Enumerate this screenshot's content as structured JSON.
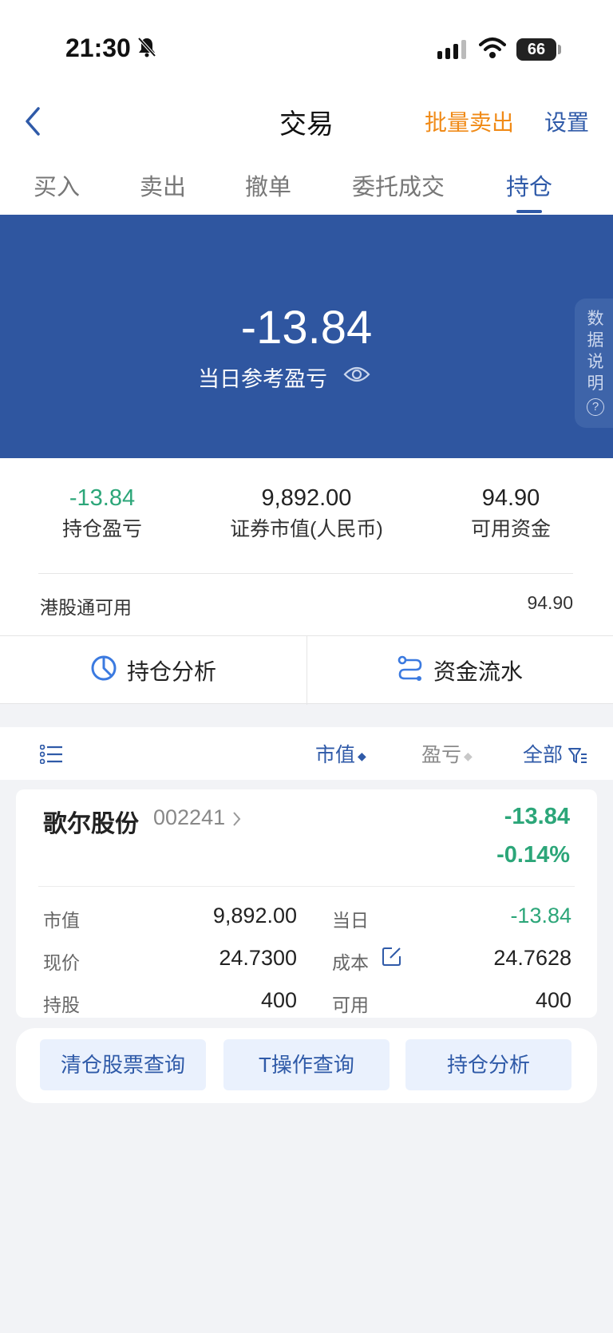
{
  "status_bar": {
    "time": "21:30",
    "battery": "66"
  },
  "nav": {
    "title": "交易",
    "batch_sell": "批量卖出",
    "settings": "设置"
  },
  "tabs": [
    "买入",
    "卖出",
    "撤单",
    "委托成交",
    "持仓"
  ],
  "active_tab": "持仓",
  "hero": {
    "value": "-13.84",
    "label": "当日参考盈亏",
    "data_note_chars": [
      "数",
      "据",
      "说",
      "明"
    ],
    "data_note_help": "?"
  },
  "summary": {
    "position_pl": {
      "value": "-13.84",
      "label": "持仓盈亏"
    },
    "market_value": {
      "value": "9,892.00",
      "label": "证券市值(人民币)"
    },
    "available_funds": {
      "value": "94.90",
      "label": "可用资金"
    },
    "hk_connect": {
      "label": "港股通可用",
      "value": "94.90"
    }
  },
  "actions": {
    "analysis": "持仓分析",
    "cash_flow": "资金流水"
  },
  "list_header": {
    "market_value": "市值",
    "pl": "盈亏",
    "all": "全部"
  },
  "holding": {
    "name": "歌尔股份",
    "code": "002241",
    "pl_amount": "-13.84",
    "pl_percent": "-0.14%",
    "market_value_label": "市值",
    "market_value": "9,892.00",
    "today_label": "当日",
    "today": "-13.84",
    "price_label": "现价",
    "price": "24.7300",
    "cost_label": "成本",
    "cost": "24.7628",
    "shares_label": "持股",
    "shares": "400",
    "available_label": "可用",
    "available": "400"
  },
  "quick_actions": [
    "清仓股票查询",
    "T操作查询",
    "持仓分析"
  ],
  "colors": {
    "brand_blue": "#2f56a0",
    "accent_orange": "#f08a17",
    "gain_green": "#2ca679",
    "link_blue": "#2f5aa8"
  }
}
